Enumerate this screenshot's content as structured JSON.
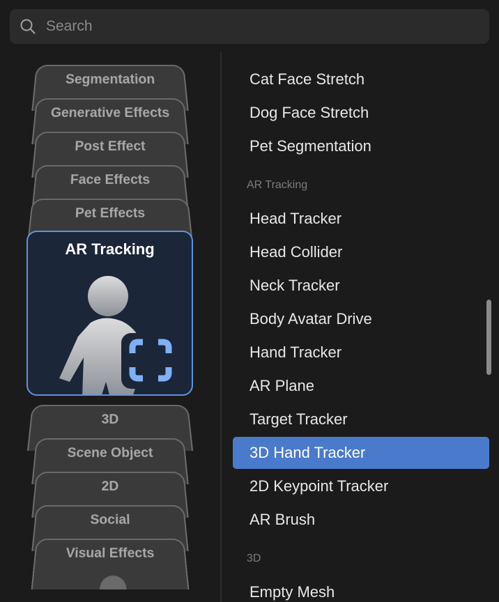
{
  "search": {
    "placeholder": "Search",
    "icon": "search-icon"
  },
  "categories_top": [
    "Segmentation",
    "Generative Effects",
    "Post Effect",
    "Face Effects",
    "Pet Effects"
  ],
  "selected_category": {
    "label": "AR Tracking",
    "icon": "person-tracking-icon",
    "accent": "#5e94e0"
  },
  "categories_bottom": [
    "3D",
    "Scene Object",
    "2D",
    "Social",
    "Visual Effects"
  ],
  "list": {
    "items_before": [
      "Cat Face Stretch",
      "Dog Face Stretch",
      "Pet Segmentation"
    ],
    "section_ar": "AR Tracking",
    "ar_items": [
      "Head Tracker",
      "Head Collider",
      "Neck Tracker",
      "Body Avatar Drive",
      "Hand Tracker",
      "AR Plane",
      "Target Tracker",
      "3D Hand Tracker",
      "2D Keypoint Tracker",
      "AR Brush"
    ],
    "selected": "3D Hand Tracker",
    "selected_color": "#4a7acb",
    "section_3d": "3D",
    "items_3d": [
      "Empty Mesh"
    ]
  }
}
